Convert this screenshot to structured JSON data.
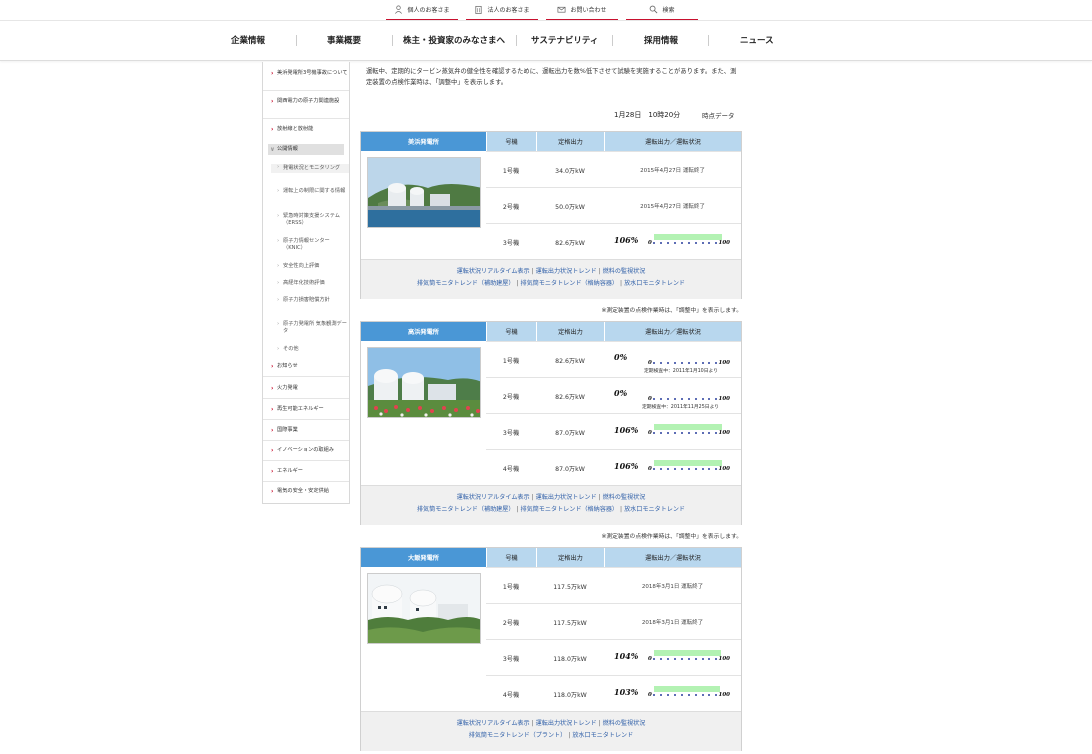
{
  "utility_nav": [
    {
      "label": "個人のお客さま",
      "icon": "person-icon"
    },
    {
      "label": "法人のお客さま",
      "icon": "building-icon"
    },
    {
      "label": "お問い合わせ",
      "icon": "mail-icon"
    },
    {
      "label": "検索",
      "icon": "search-icon"
    }
  ],
  "global_nav": [
    "企業情報",
    "事業概要",
    "株主・投資家のみなさまへ",
    "サステナビリティ",
    "採用情報",
    "ニュース"
  ],
  "sidebar": {
    "items": [
      {
        "label": "美浜発電所3号機事故について",
        "level": 1
      },
      {
        "label": "関西電力の原子力関連施設",
        "level": 1
      },
      {
        "label": "放射線と放射能",
        "level": 1
      },
      {
        "label": "公開情報",
        "level": 1,
        "active": true
      },
      {
        "label": "発電状況とモニタリング",
        "level": 2,
        "current": true
      },
      {
        "label": "運転上の制限に関する情報",
        "level": 2
      },
      {
        "label": "緊急時対策支援システム（ERSS）",
        "level": 2
      },
      {
        "label": "原子力情報センター（KNIC）",
        "level": 2
      },
      {
        "label": "安全性向上評価",
        "level": 2
      },
      {
        "label": "高経年化技術評価",
        "level": 2
      },
      {
        "label": "原子力損害賠償方針",
        "level": 2
      },
      {
        "label": "原子力発電所 気象観測データ",
        "level": 2
      },
      {
        "label": "その他",
        "level": 2
      },
      {
        "label": "お知らせ",
        "level": 1
      },
      {
        "label": "火力発電",
        "level": 1
      },
      {
        "label": "再生可能エネルギー",
        "level": 1
      },
      {
        "label": "国際事業",
        "level": 1
      },
      {
        "label": "イノベーションの取組み",
        "level": 1
      },
      {
        "label": "エネルギー",
        "level": 1
      },
      {
        "label": "電気の安全・安定供給",
        "level": 1
      }
    ]
  },
  "intro": {
    "line1": "運転中、定期的にタービン蒸気弁の健全性を確認するために、運転出力を数%低下させて試験を実施することがあります。また、測定装置の点検作業時は、「調整中」を表示します。",
    "timestamp": "1月28日　10時20分",
    "time_label": "時点データ"
  },
  "table_headers": {
    "unit": "号機",
    "capacity": "定格出力",
    "status": "運転出力／運転状況"
  },
  "gauge": {
    "min_label": "0",
    "max_label": "100"
  },
  "note": "※測定装置の点検作業時は、「調整中」を表示します。",
  "plants": [
    {
      "name": "美浜発電所",
      "units": [
        {
          "unit": "1号機",
          "capacity": "34.0万kW",
          "status_text": "2015年4月27日 運転終了"
        },
        {
          "unit": "2号機",
          "capacity": "50.0万kW",
          "status_text": "2015年4月27日 運転終了"
        },
        {
          "unit": "3号機",
          "capacity": "82.6万kW",
          "output_pct": 106,
          "output_label": "106%"
        }
      ],
      "links_line1": [
        "運転状況リアルタイム表示",
        "運転出力状況トレンド",
        "燃料の監視状況"
      ],
      "links_line2": [
        "排気筒モニタトレンド（補助建屋）",
        "排気筒モニタトレンド（格納容器）",
        "放水口モニタトレンド"
      ]
    },
    {
      "name": "高浜発電所",
      "units": [
        {
          "unit": "1号機",
          "capacity": "82.6万kW",
          "output_pct": 0,
          "output_label": "0%",
          "stop_note": "定期検査中：2011年1月10日より"
        },
        {
          "unit": "2号機",
          "capacity": "82.6万kW",
          "output_pct": 0,
          "output_label": "0%",
          "stop_note": "定期検査中：2011年11月25日より"
        },
        {
          "unit": "3号機",
          "capacity": "87.0万kW",
          "output_pct": 106,
          "output_label": "106%"
        },
        {
          "unit": "4号機",
          "capacity": "87.0万kW",
          "output_pct": 106,
          "output_label": "106%"
        }
      ],
      "links_line1": [
        "運転状況リアルタイム表示",
        "運転出力状況トレンド",
        "燃料の監視状況"
      ],
      "links_line2": [
        "排気筒モニタトレンド（補助建屋）",
        "排気筒モニタトレンド（格納容器）",
        "放水口モニタトレンド"
      ]
    },
    {
      "name": "大飯発電所",
      "units": [
        {
          "unit": "1号機",
          "capacity": "117.5万kW",
          "status_text": "2018年3月1日 運転終了"
        },
        {
          "unit": "2号機",
          "capacity": "117.5万kW",
          "status_text": "2018年3月1日 運転終了"
        },
        {
          "unit": "3号機",
          "capacity": "118.0万kW",
          "output_pct": 104,
          "output_label": "104%"
        },
        {
          "unit": "4号機",
          "capacity": "118.0万kW",
          "output_pct": 103,
          "output_label": "103%"
        }
      ],
      "links_line1": [
        "運転状況リアルタイム表示",
        "運転出力状況トレンド",
        "燃料の監視状況"
      ],
      "links_line2": [
        "排気筒モニタトレンド（プラント）",
        "放水口モニタトレンド"
      ]
    }
  ],
  "colors": {
    "accent_red": "#c8102e",
    "header_blue": "#4a97d6",
    "header_light": "#b8d7ee",
    "link_blue": "#2f5fa8",
    "gauge_green": "#b3f2b3"
  }
}
